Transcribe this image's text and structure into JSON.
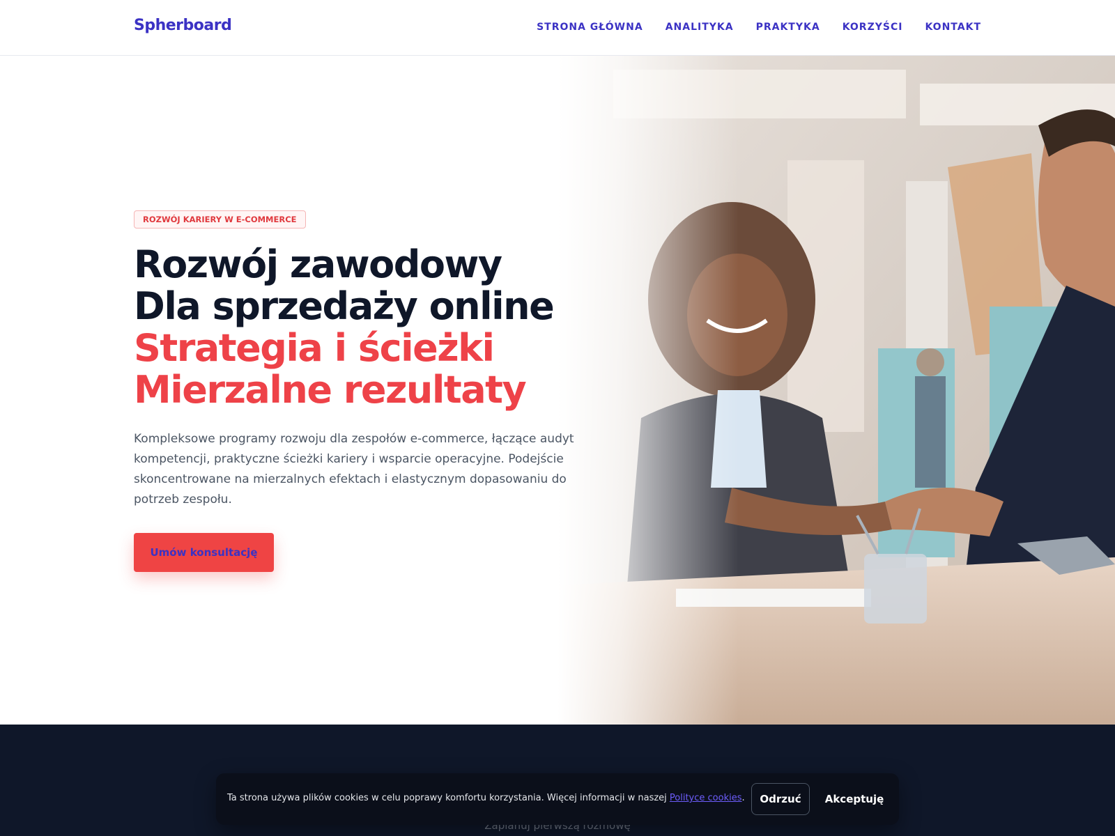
{
  "header": {
    "logo": "Spherboard",
    "nav": [
      {
        "label": "STRONA GŁÓWNA"
      },
      {
        "label": "ANALITYKA"
      },
      {
        "label": "PRAKTYKA"
      },
      {
        "label": "KORZYŚCI"
      },
      {
        "label": "KONTAKT"
      }
    ]
  },
  "hero": {
    "badge": "ROZWÓJ KARIERY W E-COMMERCE",
    "title_line1": "Rozwój zawodowy Dla sprzedaży online",
    "title_accent1": "Strategia i ścieżki",
    "title_accent2": "Mierzalne rezultaty",
    "lead": "Kompleksowe programy rozwoju dla zespołów e-commerce, łączące audyt kompetencji, praktyczne ścieżki kariery i wsparcie operacyjne. Podejście skoncentrowane na mierzalnych efektach i elastycznym dopasowaniu do potrzeb zespołu.",
    "cta": "Umów konsultację"
  },
  "next_section": {
    "partial_text": "Zaplanuj pierwszą rozmowę"
  },
  "cookie_banner": {
    "text": "Ta strona używa plików cookies w celu poprawy komfortu korzystania. Więcej informacji w naszej ",
    "link": "Polityce cookies",
    "text_end": ".",
    "reject": "Odrzuć",
    "accept": "Akceptuję"
  },
  "colors": {
    "brand": "#3b32c4",
    "accent": "#ef4444",
    "dark": "#0f1729"
  }
}
